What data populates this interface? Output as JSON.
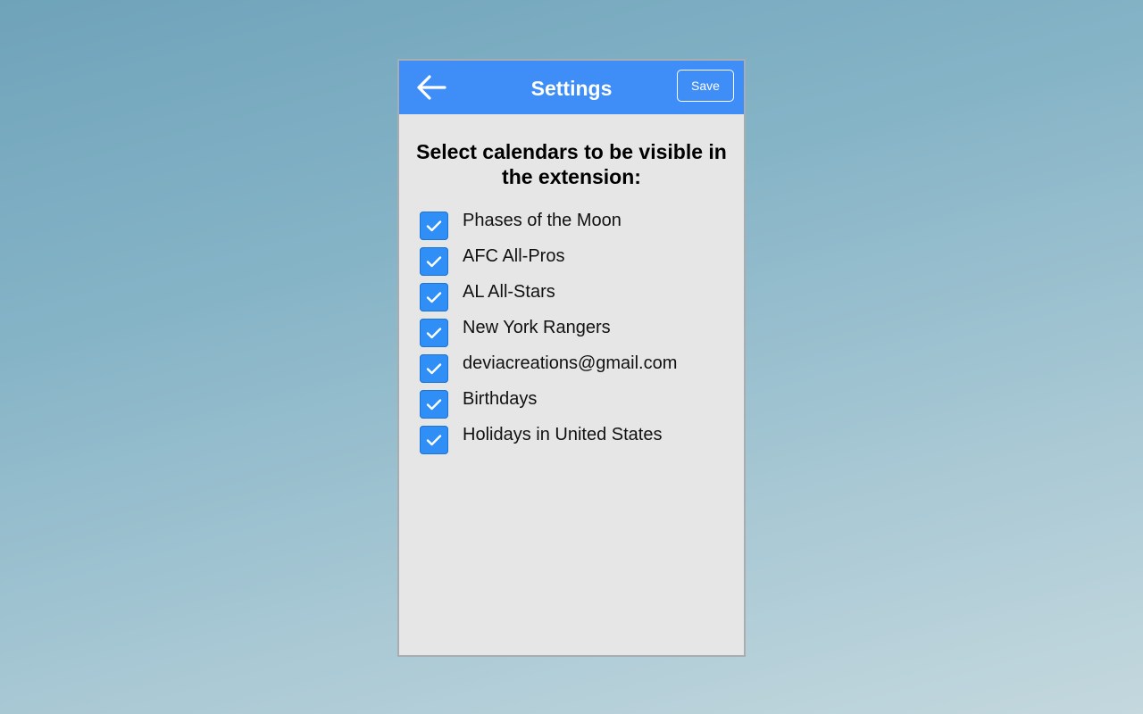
{
  "header": {
    "title": "Settings",
    "save_label": "Save",
    "back_icon": "arrow-left-icon",
    "color": "#3f8ef8"
  },
  "main": {
    "prompt": "Select calendars to be visible in the extension:",
    "calendars": [
      {
        "label": "Phases of the Moon",
        "checked": true
      },
      {
        "label": "AFC All-Pros",
        "checked": true
      },
      {
        "label": "AL All-Stars",
        "checked": true
      },
      {
        "label": "New York Rangers",
        "checked": true
      },
      {
        "label": "deviacreations@gmail.com",
        "checked": true
      },
      {
        "label": "Birthdays",
        "checked": true
      },
      {
        "label": "Holidays in United States",
        "checked": true
      }
    ]
  },
  "colors": {
    "checkbox": "#2f8ff6",
    "panel_background": "#e6e6e6"
  }
}
